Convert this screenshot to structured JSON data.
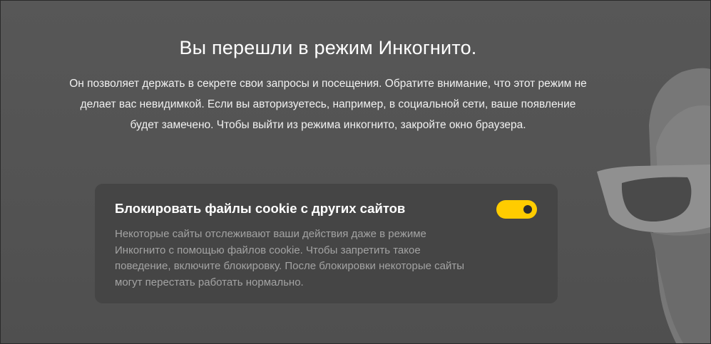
{
  "incognito": {
    "title": "Вы перешли в режим Инкогнито.",
    "description": "Он позволяет держать в секрете свои запросы и посещения. Обратите внимание, что этот режим не делает вас невидимкой. Если вы авторизуетесь, например, в социальной сети, ваше появление будет замечено. Чтобы выйти из режима инкогнито, закройте окно браузера."
  },
  "cookie_block": {
    "title": "Блокировать файлы cookie с других сайтов",
    "description": "Некоторые сайты отслеживают ваши действия даже в режиме Инкогнито с помощью файлов cookie. Чтобы запретить такое поведение, включите блокировку. После блокировки некоторые сайты могут перестать работать нормально.",
    "toggle_enabled": true
  },
  "colors": {
    "background": "#555555",
    "panel": "#454545",
    "toggle_on": "#ffcc00",
    "title_text": "#ffffff",
    "muted_text": "#a3a3a3"
  },
  "icons": {
    "illustration": "incognito-figure-icon"
  }
}
